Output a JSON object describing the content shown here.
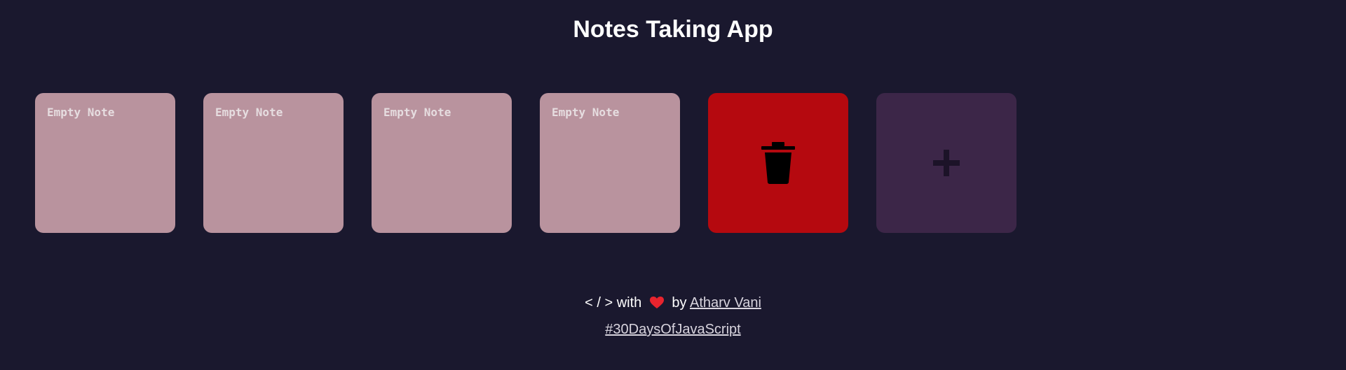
{
  "app": {
    "title": "Notes Taking App"
  },
  "notes": [
    {
      "placeholder": "Empty Note"
    },
    {
      "placeholder": "Empty Note"
    },
    {
      "placeholder": "Empty Note"
    },
    {
      "placeholder": "Empty Note"
    }
  ],
  "actions": {
    "delete_icon": "trash-icon",
    "add_icon": "plus-icon"
  },
  "footer": {
    "code_symbol": "< / >",
    "with_text": "with",
    "by_text": "by",
    "author": "Atharv Vani",
    "hashtag": "#30DaysOfJavaScript"
  },
  "colors": {
    "background": "#1a182e",
    "note": "#b9939e",
    "delete": "#b5090f",
    "add": "#3c2648",
    "heart": "#e8242e"
  }
}
